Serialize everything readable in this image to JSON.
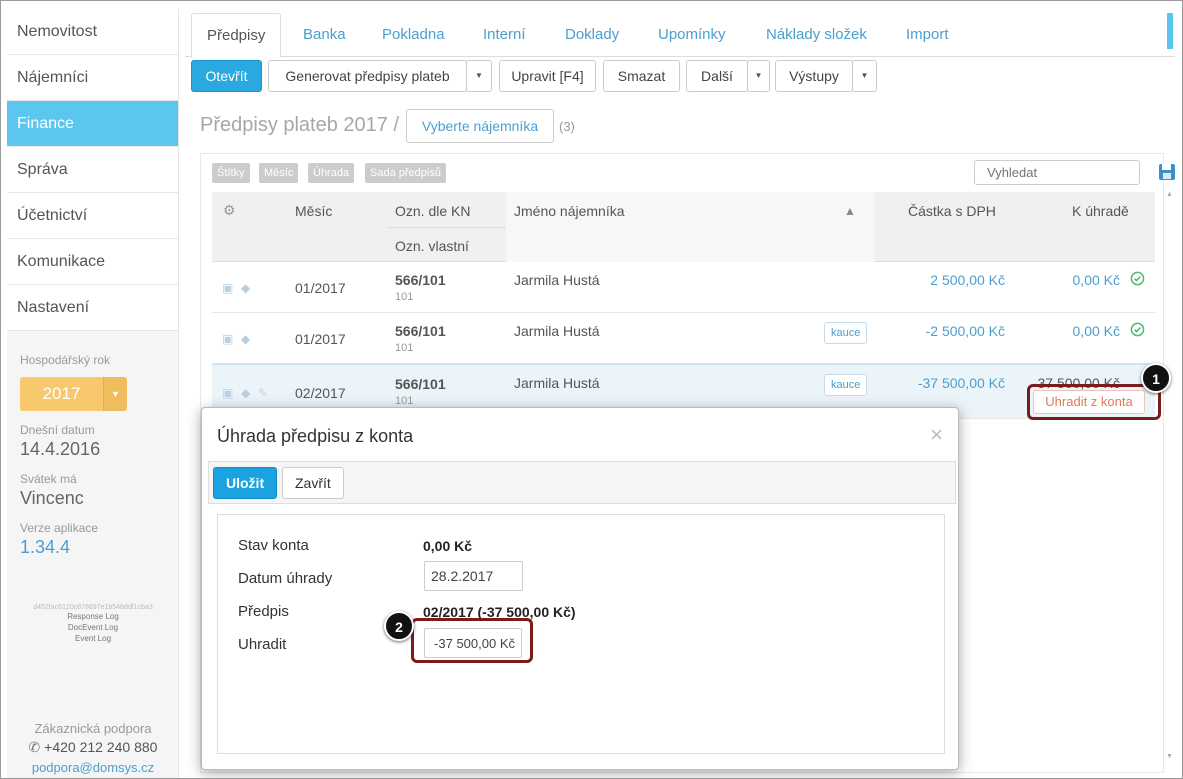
{
  "sidebar": {
    "items": [
      {
        "label": "Nemovitost"
      },
      {
        "label": "Nájemníci"
      },
      {
        "label": "Finance"
      },
      {
        "label": "Správa"
      },
      {
        "label": "Účetnictví"
      },
      {
        "label": "Komunikace"
      },
      {
        "label": "Nastavení"
      }
    ],
    "active_index": 2,
    "fiscal_year_label": "Hospodářský rok",
    "fiscal_year_value": "2017",
    "today_label": "Dnešní datum",
    "today_value": "14.4.2016",
    "nameday_label": "Svátek má",
    "nameday_value": "Vincenc",
    "version_label": "Verze aplikace",
    "version_value": "1.34.4",
    "hash": "d452fac6120c878697e1b548ddf1cba3",
    "logs": [
      "Response Log",
      "DocEvent Log",
      "Event Log"
    ],
    "support_label": "Zákaznická podpora",
    "support_phone": "+420 212 240 880",
    "support_email": "podpora@domsys.cz"
  },
  "tabs": [
    {
      "label": "Předpisy",
      "active": true
    },
    {
      "label": "Banka"
    },
    {
      "label": "Pokladna"
    },
    {
      "label": "Interní"
    },
    {
      "label": "Doklady"
    },
    {
      "label": "Upomínky"
    },
    {
      "label": "Náklady složek"
    },
    {
      "label": "Import"
    }
  ],
  "toolbar": {
    "open": "Otevřít",
    "generate": "Generovat předpisy plateb",
    "edit": "Upravit [F4]",
    "delete": "Smazat",
    "more": "Další",
    "outputs": "Výstupy"
  },
  "page": {
    "title": "Předpisy plateb 2017 /",
    "select_tenant": "Vyberte nájemníka",
    "count": "(3)"
  },
  "filters": [
    "Štítky",
    "Měsíc",
    "Úhrada",
    "Sada předpisů"
  ],
  "search": {
    "placeholder": "Vyhledat"
  },
  "table": {
    "headers": {
      "month": "Měsíc",
      "kn": "Ozn. dle KN",
      "own": "Ozn. vlastní",
      "tenant": "Jméno nájemníka",
      "amount": "Částka s DPH",
      "due": "K úhradě"
    },
    "rows": [
      {
        "month": "01/2017",
        "kn": "566/101",
        "own": "101",
        "tenant": "Jarmila Hustá",
        "tag": "",
        "amount": "2 500,00 Kč",
        "due": "0,00 Kč"
      },
      {
        "month": "01/2017",
        "kn": "566/101",
        "own": "101",
        "tenant": "Jarmila Hustá",
        "tag": "kauce",
        "amount": "-2 500,00 Kč",
        "due": "0,00 Kč"
      },
      {
        "month": "02/2017",
        "kn": "566/101",
        "own": "101",
        "tenant": "Jarmila Hustá",
        "tag": "kauce",
        "amount": "-37 500,00 Kč",
        "due": "-37 500,00 Kč"
      }
    ],
    "pay_from_account": "Uhradit z konta"
  },
  "callouts": [
    "1",
    "2"
  ],
  "modal": {
    "title": "Úhrada předpisu z konta",
    "save": "Uložit",
    "close": "Zavřít",
    "account_label": "Stav konta",
    "account_value": "0,00 Kč",
    "date_label": "Datum úhrady",
    "date_value": "28.2.2017",
    "prescription_label": "Předpis",
    "prescription_value": "02/2017 (-37 500,00 Kč)",
    "pay_label": "Uhradit",
    "pay_value": "-37 500,00 Kč"
  },
  "colors": {
    "accent": "#5bc6ef",
    "primary_button": "#2aa8e0",
    "link": "#4a9fd0",
    "success": "#4cbb6c",
    "callout_border": "#7b1c1c",
    "year_button": "#f7c86e"
  }
}
